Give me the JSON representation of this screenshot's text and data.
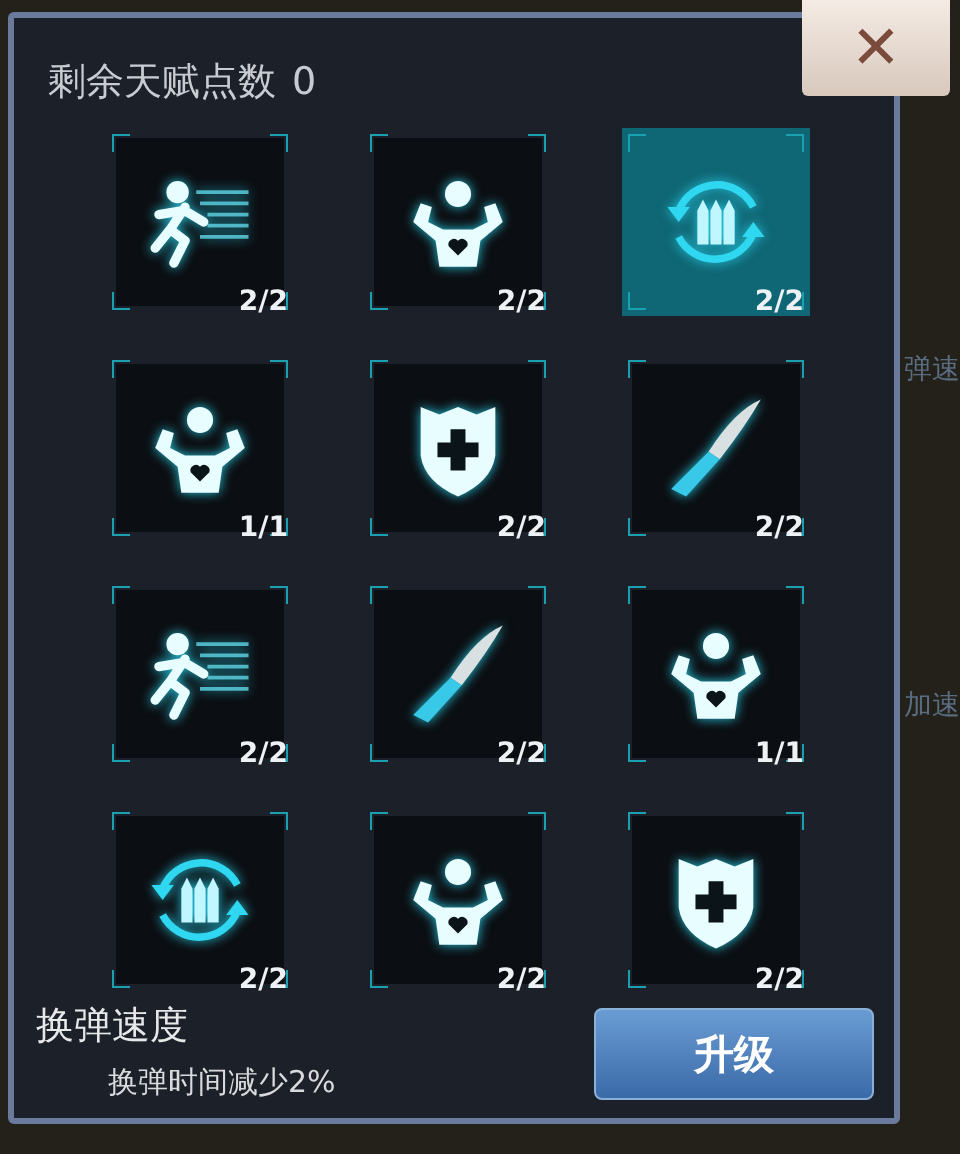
{
  "header": {
    "label": "剩余天赋点数",
    "points": "0"
  },
  "close": {
    "label": "✕"
  },
  "talents": [
    {
      "kind": "run",
      "count": "2/2",
      "selected": false
    },
    {
      "kind": "muscle",
      "count": "2/2",
      "selected": false
    },
    {
      "kind": "reload",
      "count": "2/2",
      "selected": true
    },
    {
      "kind": "muscle",
      "count": "1/1",
      "selected": false
    },
    {
      "kind": "shield",
      "count": "2/2",
      "selected": false
    },
    {
      "kind": "blade",
      "count": "2/2",
      "selected": false
    },
    {
      "kind": "run",
      "count": "2/2",
      "selected": false
    },
    {
      "kind": "blade",
      "count": "2/2",
      "selected": false
    },
    {
      "kind": "muscle",
      "count": "1/1",
      "selected": false
    },
    {
      "kind": "reload",
      "count": "2/2",
      "selected": false
    },
    {
      "kind": "muscle",
      "count": "2/2",
      "selected": false
    },
    {
      "kind": "shield",
      "count": "2/2",
      "selected": false
    }
  ],
  "detail": {
    "name": "换弹速度",
    "description": "换弹时间减少2%"
  },
  "upgrade_button": "升级",
  "background_labels": [
    "弹速",
    "加速"
  ]
}
